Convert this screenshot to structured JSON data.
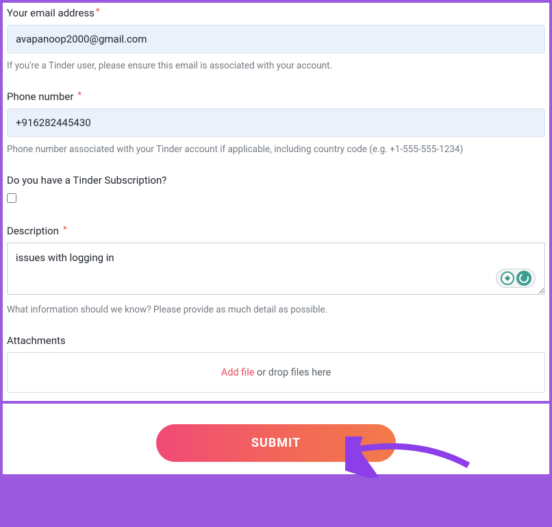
{
  "email": {
    "label": "Your email address",
    "value": "avapanoop2000@gmail.com",
    "help": "If you're a Tinder user, please ensure this email is associated with your account."
  },
  "phone": {
    "label": "Phone number",
    "value": "+916282445430",
    "help": "Phone number associated with your Tinder account if applicable, including country code (e.g. +1-555-555-1234)"
  },
  "subscription": {
    "label": "Do you have a Tinder Subscription?"
  },
  "description": {
    "label": "Description",
    "value": "issues with logging in",
    "help": "What information should we know? Please provide as much detail as possible."
  },
  "attachments": {
    "label": "Attachments",
    "add_file": "Add file",
    "drop_text": " or drop files here"
  },
  "submit": {
    "label": "SUBMIT"
  }
}
